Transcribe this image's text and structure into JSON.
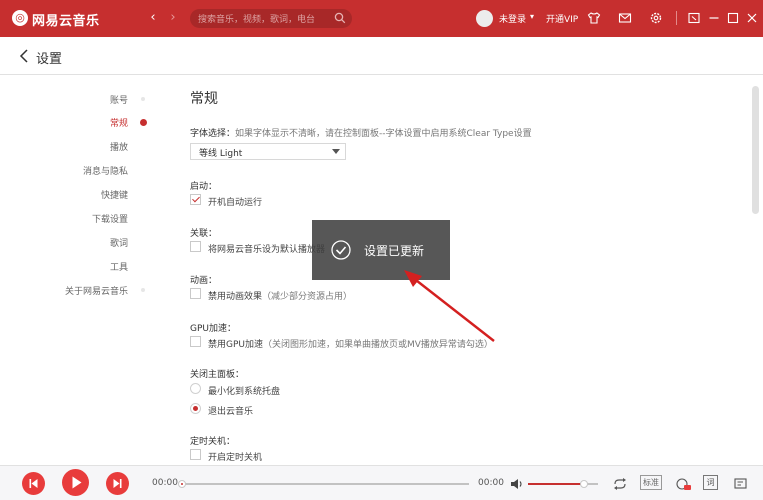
{
  "app": {
    "title": "网易云音乐",
    "logo_glyph": "◎",
    "brand_color": "#c62f2f"
  },
  "topbar": {
    "search_placeholder": "搜索音乐，视频，歌词，电台",
    "login_label": "未登录",
    "login_caret": "▾",
    "vip_label": "开通VIP",
    "icons": [
      "shirt-icon",
      "mail-icon",
      "gear-icon",
      "mini-mode-icon",
      "minimize-icon",
      "maximize-icon",
      "close-icon"
    ]
  },
  "header": {
    "title": "设置"
  },
  "sidebar": {
    "items": [
      {
        "label": "账号"
      },
      {
        "label": "常规",
        "active": true
      },
      {
        "label": "播放"
      },
      {
        "label": "消息与隐私"
      },
      {
        "label": "快捷键"
      },
      {
        "label": "下载设置"
      },
      {
        "label": "歌词"
      },
      {
        "label": "工具"
      },
      {
        "label": "关于网易云音乐"
      }
    ]
  },
  "main": {
    "section_title": "常规",
    "font": {
      "label": "字体选择：",
      "hint": "如果字体显示不清晰，请在控制面板--字体设置中启用系统Clear Type设置",
      "value": "等线 Light"
    },
    "startup": {
      "label": "启动：",
      "option": "开机自动运行",
      "checked": true
    },
    "assoc": {
      "label": "关联：",
      "option": "将网易云音乐设为默认播放器",
      "checked": false
    },
    "animation": {
      "label": "动画：",
      "option": "禁用动画效果",
      "hint": "（减少部分资源占用）",
      "checked": false
    },
    "gpu": {
      "label": "GPU加速：",
      "option": "禁用GPU加速",
      "hint": "（关闭图形加速，如果单曲播放页或MV播放异常请勾选）",
      "checked": false
    },
    "close_panel": {
      "label": "关闭主面板：",
      "options": [
        {
          "label": "最小化到系统托盘",
          "selected": false
        },
        {
          "label": "退出云音乐",
          "selected": true
        }
      ]
    },
    "timer": {
      "label": "定时关机：",
      "option": "开启定时关机",
      "checked": false
    }
  },
  "toast": {
    "text": "设置已更新"
  },
  "player": {
    "current_time": "00:00",
    "total_time": "00:00",
    "progress": 0,
    "volume": 0.8,
    "mode_label": "标准",
    "lyric_label": "词",
    "accent": "#e83c3c"
  }
}
